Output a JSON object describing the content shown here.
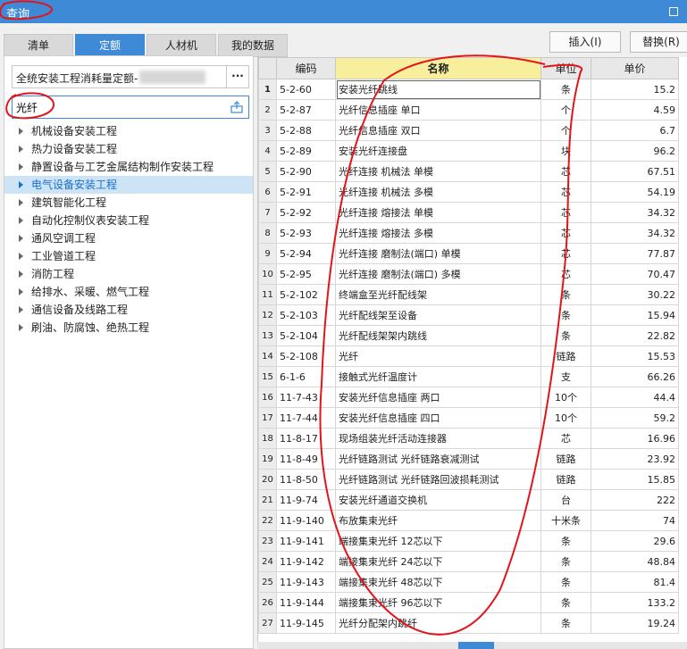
{
  "window": {
    "title": "查询"
  },
  "tabs": [
    {
      "label": "清单"
    },
    {
      "label": "定额"
    },
    {
      "label": "人材机"
    },
    {
      "label": "我的数据"
    }
  ],
  "toolbar": {
    "insert_label": "插入(I)",
    "replace_label": "替换(R)"
  },
  "left": {
    "database": "全统安装工程消耗量定额-",
    "database_more": "···",
    "search_value": "光纤",
    "tree": [
      "机械设备安装工程",
      "热力设备安装工程",
      "静置设备与工艺金属结构制作安装工程",
      "电气设备安装工程",
      "建筑智能化工程",
      "自动化控制仪表安装工程",
      "通风空调工程",
      "工业管道工程",
      "消防工程",
      "给排水、采暖、燃气工程",
      "通信设备及线路工程",
      "刷油、防腐蚀、绝热工程"
    ]
  },
  "grid": {
    "columns": [
      "编码",
      "名称",
      "单位",
      "单价"
    ],
    "rows": [
      [
        "1",
        "5-2-60",
        "安装光纤跳线",
        "条",
        "15.2"
      ],
      [
        "2",
        "5-2-87",
        "光纤信息插座 单口",
        "个",
        "4.59"
      ],
      [
        "3",
        "5-2-88",
        "光纤信息插座 双口",
        "个",
        "6.7"
      ],
      [
        "4",
        "5-2-89",
        "安装光纤连接盘",
        "块",
        "96.2"
      ],
      [
        "5",
        "5-2-90",
        "光纤连接 机械法 单模",
        "芯",
        "67.51"
      ],
      [
        "6",
        "5-2-91",
        "光纤连接 机械法 多模",
        "芯",
        "54.19"
      ],
      [
        "7",
        "5-2-92",
        "光纤连接 熔接法 单模",
        "芯",
        "34.32"
      ],
      [
        "8",
        "5-2-93",
        "光纤连接 熔接法 多模",
        "芯",
        "34.32"
      ],
      [
        "9",
        "5-2-94",
        "光纤连接 磨制法(端口) 单模",
        "芯",
        "77.87"
      ],
      [
        "10",
        "5-2-95",
        "光纤连接 磨制法(端口) 多模",
        "芯",
        "70.47"
      ],
      [
        "11",
        "5-2-102",
        "终端盒至光纤配线架",
        "条",
        "30.22"
      ],
      [
        "12",
        "5-2-103",
        "光纤配线架至设备",
        "条",
        "15.94"
      ],
      [
        "13",
        "5-2-104",
        "光纤配线架架内跳线",
        "条",
        "22.82"
      ],
      [
        "14",
        "5-2-108",
        "光纤",
        "链路",
        "15.53"
      ],
      [
        "15",
        "6-1-6",
        "接触式光纤温度计",
        "支",
        "66.26"
      ],
      [
        "16",
        "11-7-43",
        "安装光纤信息插座 两口",
        "10个",
        "44.4"
      ],
      [
        "17",
        "11-7-44",
        "安装光纤信息插座 四口",
        "10个",
        "59.2"
      ],
      [
        "18",
        "11-8-17",
        "现场组装光纤活动连接器",
        "芯",
        "16.96"
      ],
      [
        "19",
        "11-8-49",
        "光纤链路测试 光纤链路衰减测试",
        "链路",
        "23.92"
      ],
      [
        "20",
        "11-8-50",
        "光纤链路测试 光纤链路回波损耗测试",
        "链路",
        "15.85"
      ],
      [
        "21",
        "11-9-74",
        "安装光纤通道交换机",
        "台",
        "222"
      ],
      [
        "22",
        "11-9-140",
        "布放集束光纤",
        "十米条",
        "74"
      ],
      [
        "23",
        "11-9-141",
        "端接集束光纤 12芯以下",
        "条",
        "29.6"
      ],
      [
        "24",
        "11-9-142",
        "端接集束光纤 24芯以下",
        "条",
        "48.84"
      ],
      [
        "25",
        "11-9-143",
        "端接集束光纤 48芯以下",
        "条",
        "81.4"
      ],
      [
        "26",
        "11-9-144",
        "端接集束光纤 96芯以下",
        "条",
        "133.2"
      ],
      [
        "27",
        "11-9-145",
        "光纤分配架内跳纤",
        "条",
        "19.24"
      ]
    ]
  },
  "colors": {
    "accent": "#3e8ad6",
    "annotation": "#e3141a",
    "name_header": "#f7ef9b"
  }
}
